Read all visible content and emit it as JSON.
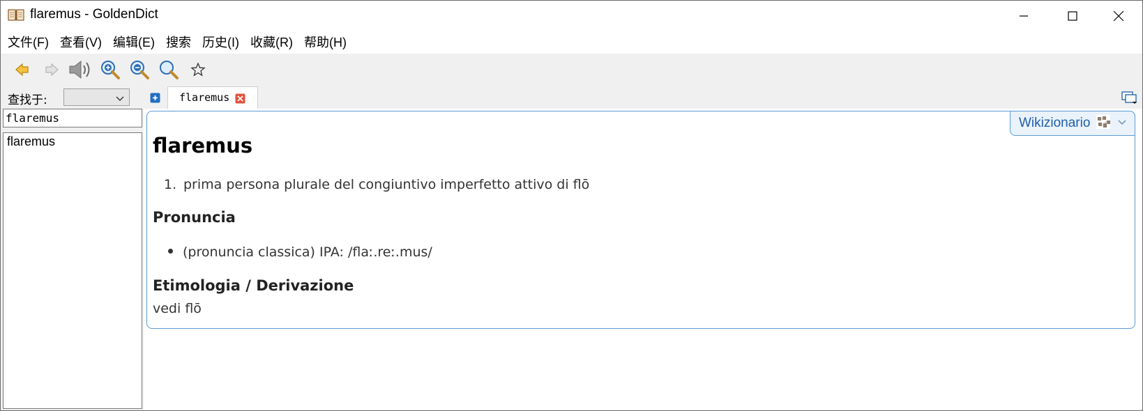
{
  "window": {
    "title": "flaremus - GoldenDict"
  },
  "menu": {
    "items": [
      "文件(F)",
      "查看(V)",
      "编辑(E)",
      "搜索",
      "历史(I)",
      "收藏(R)",
      "帮助(H)"
    ]
  },
  "toolbar": {
    "icons": [
      "back-arrow-icon",
      "forward-arrow-icon",
      "speaker-icon",
      "zoom-in-icon",
      "zoom-out-icon",
      "zoom-reset-icon",
      "star-icon"
    ]
  },
  "left_panel": {
    "search_in_label": "查找于:",
    "search_in_value": "",
    "word_input_value": "flaremus",
    "word_list": [
      "flaremus"
    ]
  },
  "tabs": [
    {
      "label": "flaremus"
    }
  ],
  "article": {
    "dictionary_name": "Wikizionario",
    "headword": "flaremus",
    "definitions": [
      {
        "num": "1.",
        "text": "prima persona plurale del congiuntivo imperfetto attivo di flō"
      }
    ],
    "pronuncia_heading": "Pronuncia",
    "pronuncia_item": "(pronuncia classica) IPA: /flaː.reː.mus/",
    "etimologia_heading": "Etimologia / Derivazione",
    "etimologia_text": "vedi flō"
  },
  "colors": {
    "accent": "#5b9bd5",
    "toolbar_bg": "#f0f0f0",
    "dict_badge_bg": "#eaf2fb",
    "dict_name": "#1f5fa8"
  }
}
